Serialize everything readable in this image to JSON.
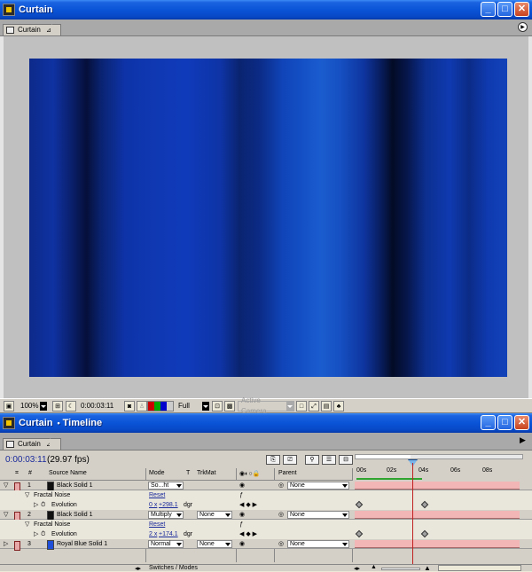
{
  "composition_window": {
    "title": "Curtain",
    "tab": "Curtain",
    "toolbar": {
      "zoom": "100%",
      "timecode": "0:00:03:11",
      "resolution": "Full",
      "camera": "Active Camera"
    }
  },
  "timeline_window": {
    "title": "Curtain",
    "title_suffix": "Timeline",
    "tab": "Curtain",
    "timecode": "0:00:03:11",
    "fps": "(29.97 fps)",
    "headers": {
      "number": "#",
      "source_name": "Source Name",
      "mode": "Mode",
      "t": "T",
      "trkmat": "TrkMat",
      "parent": "Parent"
    },
    "ruler_ticks": [
      "00s",
      "02s",
      "04s",
      "06s",
      "08s"
    ],
    "layers": [
      {
        "num": "1",
        "name": "Black Solid 1",
        "mode": "So...ht",
        "trkmat": "",
        "parent": "None",
        "color": "#111111"
      },
      {
        "effect": "Fractal Noise",
        "reset": "Reset"
      },
      {
        "property": "Evolution",
        "value_rev": "0 x",
        "value_deg": "+298.1",
        "unit": "dgr"
      },
      {
        "num": "2",
        "name": "Black Solid 1",
        "mode": "Multiply",
        "trkmat": "None",
        "parent": "None",
        "color": "#111111"
      },
      {
        "effect": "Fractal Noise",
        "reset": "Reset"
      },
      {
        "property": "Evolution",
        "value_rev": "2 x",
        "value_deg": "+174.1",
        "unit": "dgr"
      },
      {
        "num": "3",
        "name": "Royal Blue Solid 1",
        "mode": "Normal",
        "trkmat": "None",
        "parent": "None",
        "color": "#1f4fd8"
      }
    ],
    "footer": {
      "switches_modes": "Switches / Modes"
    }
  },
  "colors": {
    "title_bar": "#0a54d8",
    "layer_bar": "#f3b6b6",
    "time_indicator": "#c02020",
    "timecode_text": "#1a2a9a"
  }
}
